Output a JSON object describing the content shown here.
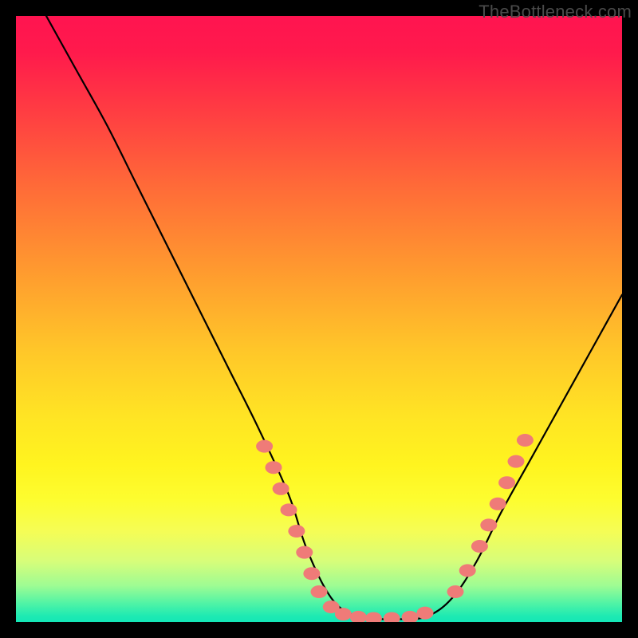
{
  "watermark": "TheBottleneck.com",
  "chart_data": {
    "type": "line",
    "title": "",
    "xlabel": "",
    "ylabel": "",
    "xlim": [
      0,
      100
    ],
    "ylim": [
      0,
      100
    ],
    "grid": false,
    "legend": false,
    "series": [
      {
        "name": "bottleneck-curve",
        "color": "#000000",
        "x": [
          5,
          10,
          15,
          20,
          25,
          30,
          35,
          40,
          45,
          48,
          52,
          56,
          60,
          64,
          68,
          72,
          76,
          80,
          85,
          90,
          95,
          100
        ],
        "y": [
          100,
          91,
          82,
          72,
          62,
          52,
          42,
          32,
          21,
          12,
          4,
          1,
          0.5,
          0.5,
          1,
          4,
          10,
          18,
          27,
          36,
          45,
          54
        ]
      }
    ],
    "markers": {
      "name": "highlight-dots",
      "color": "#ef7b78",
      "points": [
        {
          "x": 41.0,
          "y": 29.0
        },
        {
          "x": 42.5,
          "y": 25.5
        },
        {
          "x": 43.7,
          "y": 22.0
        },
        {
          "x": 45.0,
          "y": 18.5
        },
        {
          "x": 46.3,
          "y": 15.0
        },
        {
          "x": 47.6,
          "y": 11.5
        },
        {
          "x": 48.8,
          "y": 8.0
        },
        {
          "x": 50.0,
          "y": 5.0
        },
        {
          "x": 52.0,
          "y": 2.5
        },
        {
          "x": 54.0,
          "y": 1.3
        },
        {
          "x": 56.5,
          "y": 0.8
        },
        {
          "x": 59.0,
          "y": 0.6
        },
        {
          "x": 62.0,
          "y": 0.6
        },
        {
          "x": 65.0,
          "y": 0.8
        },
        {
          "x": 67.5,
          "y": 1.5
        },
        {
          "x": 72.5,
          "y": 5.0
        },
        {
          "x": 74.5,
          "y": 8.5
        },
        {
          "x": 76.5,
          "y": 12.5
        },
        {
          "x": 78.0,
          "y": 16.0
        },
        {
          "x": 79.5,
          "y": 19.5
        },
        {
          "x": 81.0,
          "y": 23.0
        },
        {
          "x": 82.5,
          "y": 26.5
        },
        {
          "x": 84.0,
          "y": 30.0
        }
      ]
    },
    "background_gradient": {
      "top": "#ff1450",
      "mid": "#fff41f",
      "bottom": "#14e6b6"
    }
  }
}
